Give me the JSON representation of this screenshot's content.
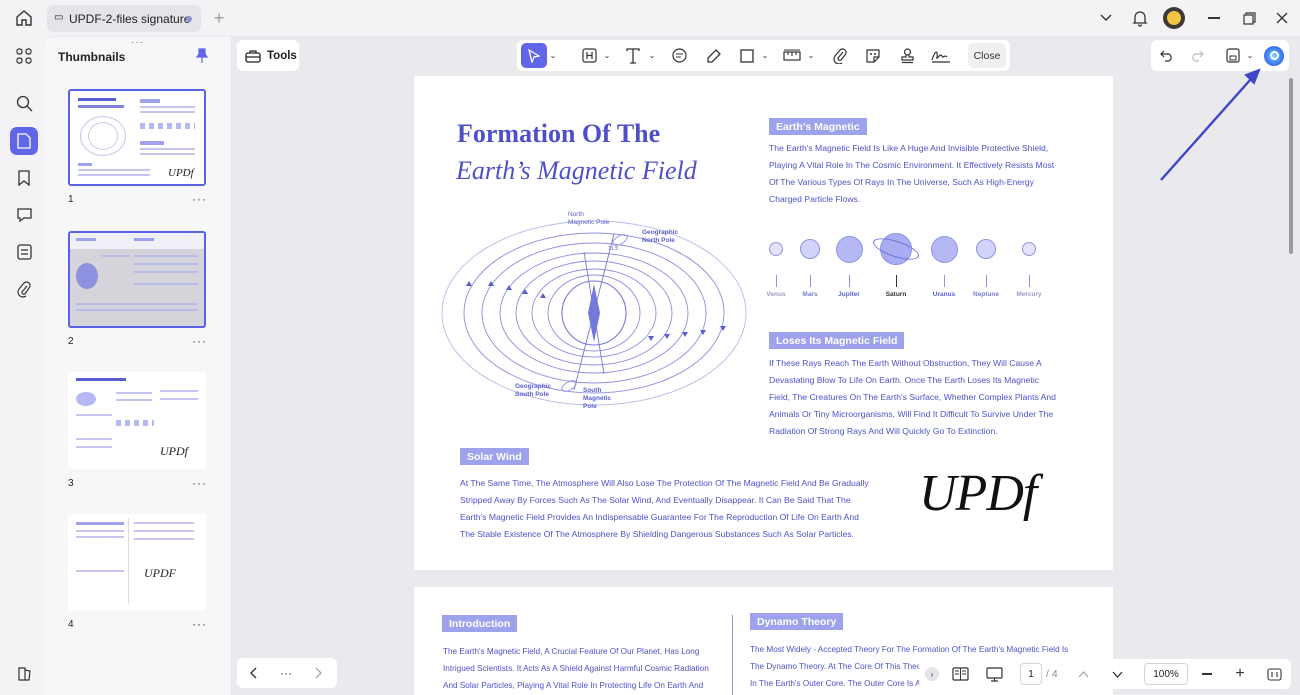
{
  "tab": {
    "title": "UPDF-2-files signature"
  },
  "thumbnails": {
    "title": "Thumbnails",
    "items": [
      {
        "page": "1",
        "more": "···"
      },
      {
        "page": "2",
        "more": "···"
      },
      {
        "page": "3",
        "more": "···"
      },
      {
        "page": "4",
        "more": "···"
      }
    ]
  },
  "toolbar": {
    "tools_label": "Tools",
    "close_label": "Close"
  },
  "document": {
    "title_line1": "Formation Of The",
    "title_line2": "Earth’s Magnetic Field",
    "diagram": {
      "north_magnetic": "North\nMagnetic Pole",
      "geo_north": "Geographic\nNorth Pole",
      "angle": "11.5",
      "geo_south": "Geographic\nSouth Pole",
      "south_magnetic": "South\nMagnetic\nPole"
    },
    "section1": {
      "heading": "Earth's Magnetic",
      "lines": [
        "The Earth's Magnetic Field Is Like A Huge And Invisible Protective Shield,",
        "Playing A Vital Role In The Cosmic Environment. It Effectively Resists Most",
        "Of The Various Types Of Rays In The Universe, Such As High-Energy",
        "Charged Particle Flows."
      ]
    },
    "planets": [
      "Venus",
      "Mars",
      "Jupiter",
      "Saturn",
      "Uranus",
      "Neptune",
      "Mercury"
    ],
    "section2": {
      "heading": "Loses Its Magnetic Field",
      "lines": [
        "If These Rays Reach The Earth Without Obstruction, They Will Cause A",
        "Devastating Blow To Life On Earth. Once The Earth Loses Its Magnetic",
        "Field, The Creatures On The Earth's Surface, Whether Complex Plants And",
        "Animals Or Tiny Microorganisms, Will Find It Difficult To Survive Under The",
        "Radiation Of Strong Rays And Will Quickly Go To Extinction."
      ]
    },
    "section3": {
      "heading": "Solar Wind",
      "lines": [
        "At The Same Time, The Atmosphere Will Also Lose The Protection Of The Magnetic Field And Be Gradually",
        "Stripped Away By Forces Such As The Solar Wind, And Eventually Disappear. It Can Be Said That The",
        "Earth's Magnetic Field Provides An Indispensable Guarantee For The Reproduction Of Life On Earth And",
        "The Stable Existence Of The Atmosphere By Shielding Dangerous Substances Such As Solar Particles."
      ]
    },
    "signature": "UPDf"
  },
  "page2": {
    "intro": {
      "heading": "Introduction",
      "lines": [
        "The Earth's Magnetic Field, A Crucial Feature Of Our Planet, Has Long",
        "Intrigued Scientists. It Acts As A Shield Against Harmful Cosmic Radiation",
        "And Solar Particles, Playing A Vital Role In Protecting Life On Earth And"
      ]
    },
    "dynamo": {
      "heading": "Dynamo Theory",
      "lines": [
        "The Most Widely - Accepted Theory For The Formation Of The Earth's Magnetic Field Is",
        "The Dynamo Theory. At The Core Of This Theor",
        "In The Earth's Outer Core. The Outer Core Is A I"
      ]
    }
  },
  "navigation": {
    "current_page": "1",
    "total_pages": "/ 4",
    "zoom": "100%",
    "dots": "···"
  },
  "colors": {
    "accent": "#6166e8",
    "doc_text": "#4d52c9",
    "highlight": "#9ea2ec"
  }
}
